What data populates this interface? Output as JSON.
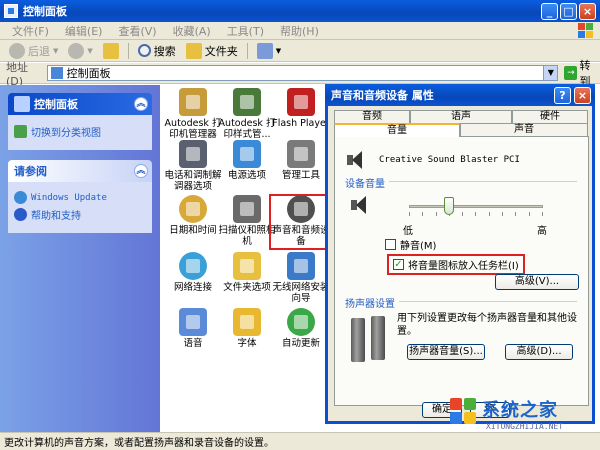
{
  "window": {
    "title": "控制面板",
    "menu": [
      "文件(F)",
      "编辑(E)",
      "查看(V)",
      "收藏(A)",
      "工具(T)",
      "帮助(H)"
    ],
    "toolbar": {
      "back": "后退",
      "search": "搜索",
      "folders": "文件夹"
    },
    "address_label": "地址(D)",
    "address_value": "控制面板",
    "go_label": "转到",
    "status": "更改计算机的声音方案，或者配置扬声器和录音设备的设置。"
  },
  "sidebar": {
    "control_panel_header": "控制面板",
    "switch_view": "切换到分类视图",
    "see_also_header": "请参阅",
    "links": [
      "Windows Update",
      "帮助和支持"
    ]
  },
  "icons": [
    {
      "label": "Autodesk 打印机管理器",
      "color": "#c79a3a"
    },
    {
      "label": "Autodesk 打印样式管...",
      "color": "#4a7a3a"
    },
    {
      "label": "Flash Player",
      "color": "#c02020"
    },
    {
      "label": "电话和调制解调器选项",
      "color": "#5a6070"
    },
    {
      "label": "电源选项",
      "color": "#3a8ad8"
    },
    {
      "label": "管理工具",
      "color": "#7a7a7a"
    },
    {
      "label": "日期和时间",
      "color": "#d8a838"
    },
    {
      "label": "扫描仪和照相机",
      "color": "#6a6a6a"
    },
    {
      "label": "声音和音频设备",
      "color": "#505050"
    },
    {
      "label": "网络连接",
      "color": "#3aa0d8"
    },
    {
      "label": "文件夹选项",
      "color": "#e8c040"
    },
    {
      "label": "无线网络安装向导",
      "color": "#3a7ac8"
    },
    {
      "label": "语音",
      "color": "#5a8ad8"
    },
    {
      "label": "字体",
      "color": "#e8b830"
    },
    {
      "label": "自动更新",
      "color": "#3aa848"
    }
  ],
  "dialog": {
    "title": "声音和音频设备 属性",
    "tabs_back": [
      "音频",
      "语声",
      "硬件"
    ],
    "tabs_front": [
      "音量",
      "声音"
    ],
    "device_name": "Creative Sound Blaster PCI",
    "device_volume_group": "设备音量",
    "volume_level": 0.3,
    "low_label": "低",
    "high_label": "高",
    "mute_label": "静音(M)",
    "mute_checked": false,
    "tray_label": "将音量图标放入任务栏(I)",
    "tray_checked": true,
    "advanced_volume_button": "高级(V)...",
    "speaker_group": "扬声器设置",
    "speaker_desc": "用下列设置更改每个扬声器音量和其他设置。",
    "speaker_volume_button": "扬声器音量(S)...",
    "speaker_advanced_button": "高级(D)...",
    "ok_button": "确定",
    "cancel_button": "取"
  },
  "watermark": {
    "text": "系统之家",
    "url": "XITONGZHIJIA.NET"
  }
}
